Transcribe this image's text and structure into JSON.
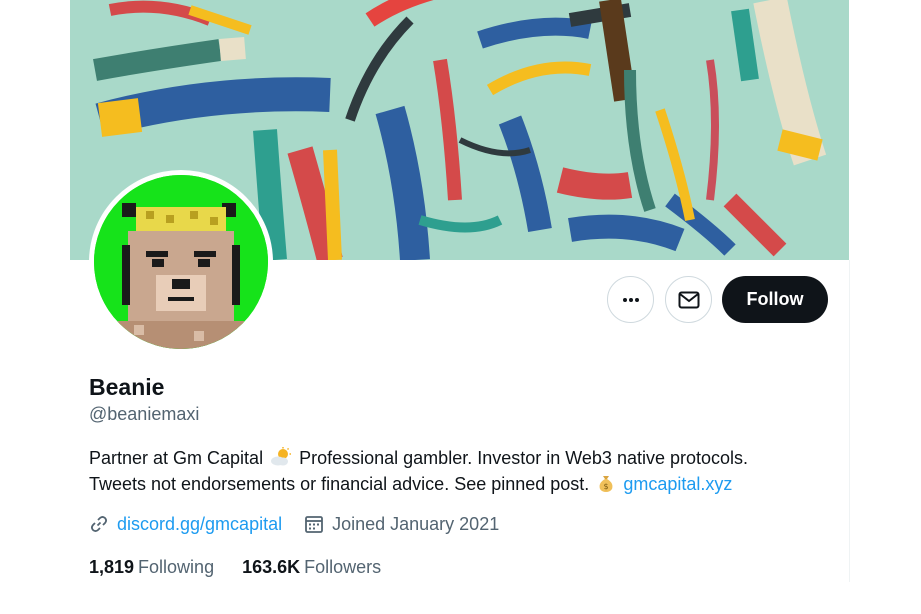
{
  "profile": {
    "name": "Beanie",
    "handle": "@beaniemaxi",
    "bio_part1": "Partner at Gm Capital",
    "bio_part2": "Professional gambler. Investor in Web3 native protocols.",
    "bio_part3": "Tweets not endorsements or financial advice. See pinned post.",
    "bio_link": "gmcapital.xyz",
    "website": "discord.gg/gmcapital",
    "joined": "Joined January 2021",
    "following_count": "1,819",
    "following_label": "Following",
    "followers_count": "163.6K",
    "followers_label": "Followers"
  },
  "actions": {
    "more_icon": "more-horizontal-icon",
    "message_icon": "envelope-icon",
    "follow_label": "Follow"
  },
  "icons": {
    "bio_emoji_1": "sun-behind-cloud-icon",
    "bio_emoji_2": "money-bag-icon",
    "website": "link-icon",
    "joined": "calendar-icon"
  },
  "colors": {
    "accent": "#1d9bf0",
    "follow_button": "#0f1419",
    "secondary_text": "#536471",
    "banner_bg": "#a9d9c9",
    "avatar_bg": "#16e31a"
  }
}
